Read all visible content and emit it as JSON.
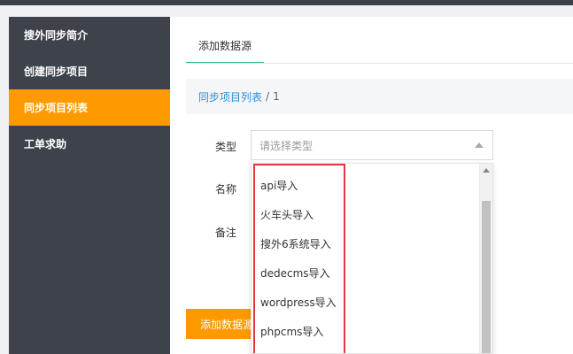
{
  "sidebar": {
    "items": [
      {
        "label": "搜外同步简介"
      },
      {
        "label": "创建同步项目"
      },
      {
        "label": "同步项目列表"
      },
      {
        "label": "工单求助"
      }
    ]
  },
  "main": {
    "tab_label": "添加数据源",
    "breadcrumb": {
      "link": "同步项目列表",
      "separator": "/",
      "current": "1"
    }
  },
  "form": {
    "type_label": "类型",
    "name_label": "名称",
    "note_label": "备注",
    "type_placeholder": "请选择类型",
    "submit_label": "添加数据源"
  },
  "dropdown": {
    "options": [
      "api导入",
      "火车头导入",
      "搜外6系统导入",
      "dedecms导入",
      "wordpress导入",
      "phpcms导入"
    ]
  },
  "colors": {
    "sidebar_bg": "#3e424b",
    "accent_orange": "#ff9900",
    "tab_underline": "#2bb09a",
    "link_blue": "#2a8fd6",
    "highlight_red": "#e0393c"
  }
}
